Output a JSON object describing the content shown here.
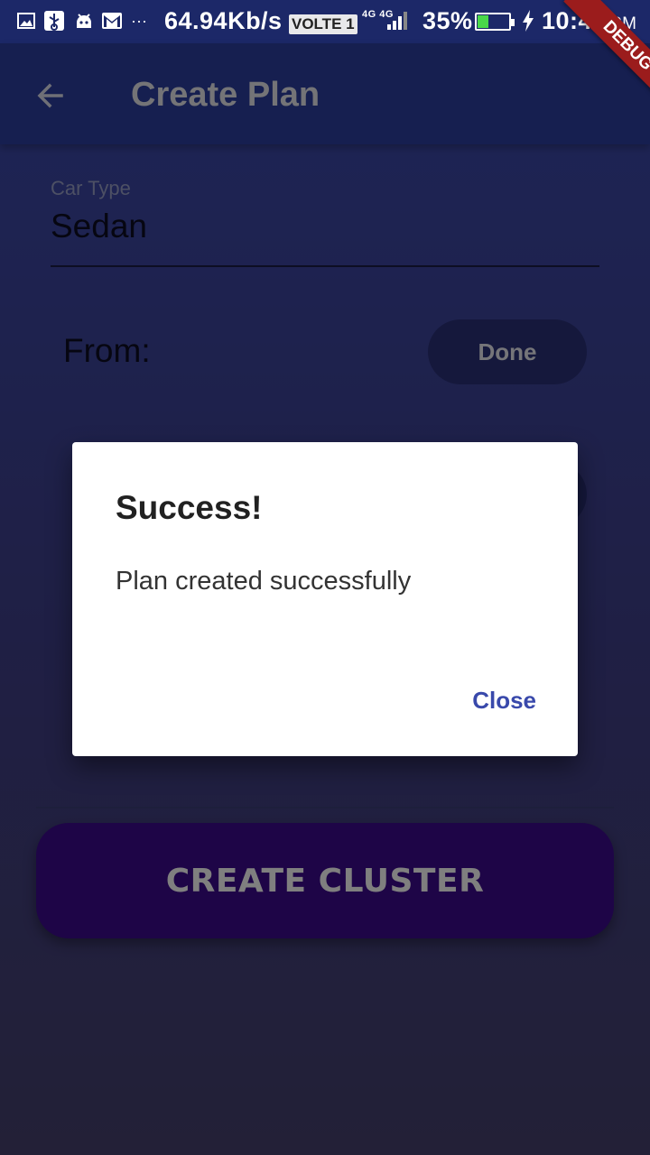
{
  "status_bar": {
    "speed": "64.94Kb/s",
    "volte": "VOLTE 1",
    "network": "4G 4G",
    "battery_percent": "35%",
    "battery_level": 0.35,
    "time": "10:49",
    "ampm": "PM"
  },
  "appbar": {
    "title": "Create Plan",
    "back_icon": "arrow-back-icon"
  },
  "form": {
    "car_type_label": "Car Type",
    "car_type_value": "Sedan",
    "from_label": "From:",
    "done_label": "Done",
    "create_label": "CREATE CLUSTER"
  },
  "dialog": {
    "title": "Success!",
    "message": "Plan created successfully",
    "close_label": "Close"
  },
  "debug_banner": "DEBUG",
  "colors": {
    "appbar": "#2c3fa0",
    "create_button": "#3d0a8e",
    "dialog_action": "#3949ab",
    "debug_ribbon": "#9b1c1c"
  }
}
